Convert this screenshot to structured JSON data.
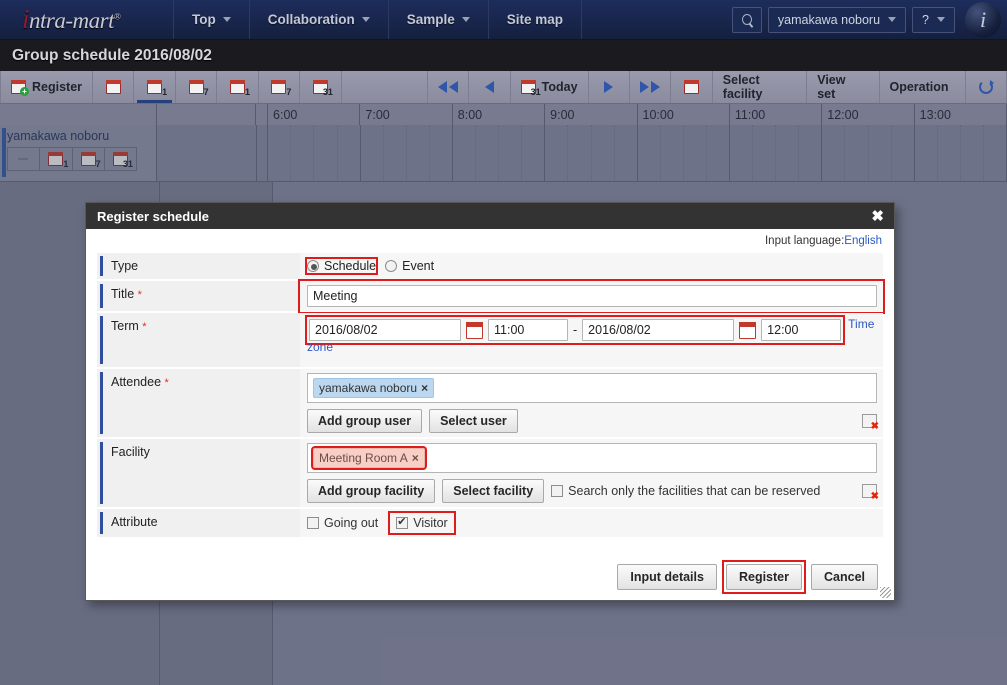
{
  "topbar": {
    "logo_text": "ntra-mart",
    "logo_initial": "i",
    "nav": [
      {
        "label": "Top",
        "caret": true
      },
      {
        "label": "Collaboration",
        "caret": true
      },
      {
        "label": "Sample",
        "caret": true
      },
      {
        "label": "Site map",
        "caret": false
      }
    ],
    "search_icon": "search-icon",
    "user": "yamakawa noboru",
    "help": "?",
    "info_badge": "i"
  },
  "page_title": "Group schedule 2016/08/02",
  "toolbar": {
    "register": "Register",
    "search_schedule_icon": "calendar-search-icon",
    "views": [
      {
        "name": "group-day-view",
        "sub": "1",
        "active": true
      },
      {
        "name": "group-week-view",
        "sub": "7",
        "active": false
      },
      {
        "name": "personal-day-view",
        "sub": "1",
        "active": false
      },
      {
        "name": "personal-week-view",
        "sub": "7",
        "active": false
      },
      {
        "name": "personal-month-view",
        "sub": "31",
        "active": false
      }
    ],
    "prev_fast": "prev-fast-icon",
    "prev": "prev-icon",
    "today": "Today",
    "next": "next-icon",
    "next_fast": "next-fast-icon",
    "calendar_picker": "calendar-icon",
    "select_facility": "Select facility",
    "view_set": "View set",
    "operation": "Operation",
    "refresh": "refresh-icon"
  },
  "calendar": {
    "hours": [
      "6:00",
      "7:00",
      "8:00",
      "9:00",
      "10:00",
      "11:00",
      "12:00",
      "13:00"
    ],
    "user_row": {
      "name": "yamakawa noboru",
      "buttons": [
        "send-icon",
        "day-1-icon",
        "week-7-icon",
        "month-31-icon"
      ]
    }
  },
  "dialog": {
    "title": "Register schedule",
    "close_icon": "close-icon",
    "input_language_label": "Input language:",
    "input_language_value": "English",
    "rows": {
      "type": {
        "label": "Type",
        "options": [
          {
            "label": "Schedule",
            "selected": true
          },
          {
            "label": "Event",
            "selected": false
          }
        ]
      },
      "title": {
        "label": "Title",
        "required": "*",
        "value": "Meeting",
        "placeholder": ""
      },
      "term": {
        "label": "Term",
        "required": "*",
        "start_date": "2016/08/02",
        "start_time": "11:00",
        "separator": "-",
        "end_date": "2016/08/02",
        "end_time": "12:00",
        "timezone_link_line1": "Time",
        "timezone_link_line2": "zone"
      },
      "attendee": {
        "label": "Attendee",
        "required": "*",
        "tags": [
          "yamakawa noboru"
        ],
        "tag_remove": "×",
        "add_group_user": "Add group user",
        "select_user": "Select user",
        "clear_icon": "broken-image-clear-icon"
      },
      "facility": {
        "label": "Facility",
        "tags": [
          "Meeting Room A"
        ],
        "tag_remove": "×",
        "add_group_facility": "Add group facility",
        "select_facility": "Select facility",
        "reserved_only_label": "Search only the facilities that can be reserved",
        "reserved_only_checked": false,
        "clear_icon": "broken-image-clear-icon"
      },
      "attribute": {
        "label": "Attribute",
        "options": [
          {
            "label": "Going out",
            "checked": false
          },
          {
            "label": "Visitor",
            "checked": true
          }
        ]
      }
    },
    "footer": {
      "input_details": "Input details",
      "register": "Register",
      "cancel": "Cancel"
    }
  },
  "colors": {
    "nav_bg": "#19264d",
    "title_bg": "#1b1b1f",
    "accent_blue": "#2f4f9e",
    "highlight_red": "#e01b1b",
    "link_blue": "#2b59c3"
  }
}
